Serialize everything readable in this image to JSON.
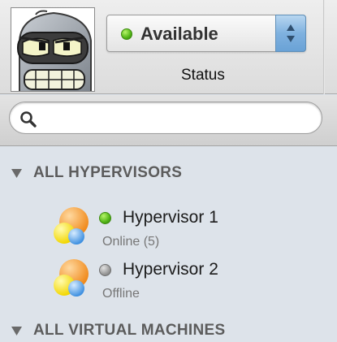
{
  "header": {
    "avatar_icon": "robot-face-avatar",
    "status_select": {
      "value": "Available",
      "indicator_color": "#52b516"
    },
    "status_label": "Status"
  },
  "search": {
    "placeholder": "",
    "value": "",
    "icon": "search-icon"
  },
  "groups": [
    {
      "title": "ALL HYPERVISORS",
      "expanded": true,
      "items": [
        {
          "name": "Hypervisor 1",
          "status": "Online (5)",
          "indicator_color": "#52b516"
        },
        {
          "name": "Hypervisor 2",
          "status": "Offline",
          "indicator_color": "#9a9a9a"
        }
      ]
    },
    {
      "title": "ALL VIRTUAL MACHINES",
      "expanded": true,
      "items": []
    }
  ]
}
